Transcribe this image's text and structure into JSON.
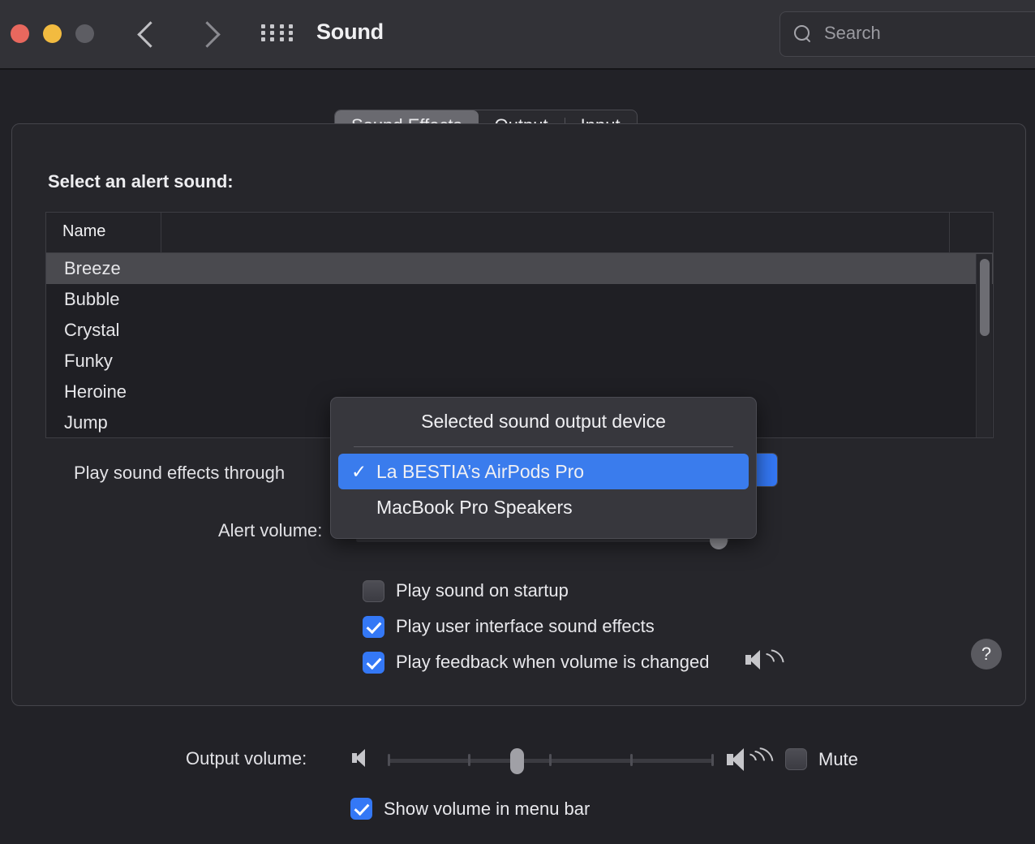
{
  "titlebar": {
    "title": "Sound",
    "back_icon": "chevron-left-icon",
    "forward_icon": "chevron-right-icon",
    "grid_icon": "grid-apps-icon",
    "search": {
      "placeholder": "Search",
      "value": "",
      "icon": "search-icon"
    },
    "traffic_lights": [
      "close",
      "minimize",
      "zoom"
    ]
  },
  "tabs": [
    {
      "label": "Sound Effects",
      "selected": true
    },
    {
      "label": "Output",
      "selected": false
    },
    {
      "label": "Input",
      "selected": false
    }
  ],
  "main": {
    "alert_sound_label": "Select an alert sound:",
    "table": {
      "column_header": "Name",
      "rows": [
        {
          "name": "Breeze",
          "selected": true
        },
        {
          "name": "Bubble",
          "selected": false
        },
        {
          "name": "Crystal",
          "selected": false
        },
        {
          "name": "Funky",
          "selected": false
        },
        {
          "name": "Heroine",
          "selected": false
        },
        {
          "name": "Jump",
          "selected": false
        }
      ],
      "scrollbar": "vertical-scrollbar"
    },
    "play_through_label": "Play sound effects through",
    "play_through_value": "",
    "alert_volume_label": "Alert volume:",
    "alert_volume_percent": 95,
    "checkboxes": [
      {
        "label": "Play sound on startup",
        "checked": false
      },
      {
        "label": "Play user interface sound effects",
        "checked": true
      },
      {
        "label": "Play feedback when volume is changed",
        "checked": true
      }
    ],
    "help_label": "?"
  },
  "footer": {
    "output_volume_label": "Output volume:",
    "output_volume_percent": 38,
    "mute_label": "Mute",
    "mute_checked": false,
    "show_volume_label": "Show volume in menu bar",
    "show_volume_checked": true,
    "speaker_low_icon": "speaker-mute-icon",
    "speaker_high_icon": "speaker-waves-icon"
  },
  "dropdown": {
    "header": "Selected sound output device",
    "items": [
      {
        "label": "La BESTIA’s AirPods Pro",
        "checked": true,
        "highlighted": true
      },
      {
        "label": "MacBook Pro Speakers",
        "checked": false,
        "highlighted": false
      }
    ],
    "check_glyph": "✓",
    "highlight_color": "#3a7ced"
  }
}
